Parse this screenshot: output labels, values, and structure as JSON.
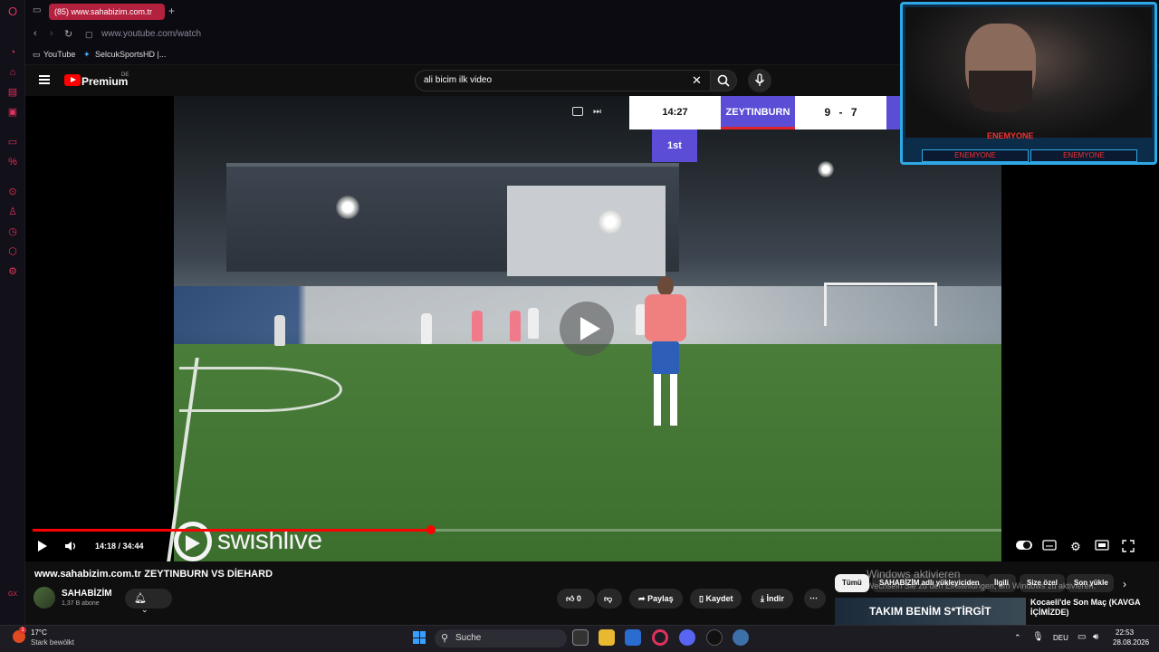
{
  "browser": {
    "tab_title": "(85) www.sahabizim.com.tr",
    "new_tab_symbol": "+",
    "url": "www.youtube.com/watch",
    "bookmarks": [
      "YouTube",
      "SelcukSportsHD |..."
    ],
    "sidebar_label": "GX"
  },
  "youtube": {
    "brand": "Premium",
    "region": "DE",
    "search_query": "ali bicim ilk video",
    "clear_symbol": "✕"
  },
  "player": {
    "current_time": "14:18 / 34:44",
    "progress_fraction": 0.4116,
    "watermark": "swishlive",
    "scoreboard": {
      "clock": "14:27",
      "team": "ZEYTINBURN",
      "score": "9 - 7",
      "period": "1st"
    }
  },
  "webcam": {
    "name": "ENEMYONE",
    "tag_left": "ENEMYONE",
    "tag_right": "ENEMYONE"
  },
  "video_info": {
    "title": "www.sahabizim.com.tr ZEYTINBURN VS DİEHARD",
    "channel": "SAHABİZİM",
    "subscribers": "1,37 B abone",
    "likes": "0",
    "share_label": "Paylaş",
    "save_label": "Kaydet",
    "download_label": "İndir"
  },
  "recommendations": {
    "chips": [
      "Tümü",
      "SAHABİZİM adlı yükleyiciden",
      "İlgili",
      "Size özel",
      "Son yükle"
    ],
    "thumb_text": "TAKIM BENİM S*TİRGİT",
    "first_title": "Kocaeli'de Son Maç (KAVGA İÇİMİZDE)"
  },
  "windows": {
    "activate_title": "Windows aktivieren",
    "activate_sub": "Wechseln Sie zu den Einstellungen, um Windows zu aktivieren.",
    "weather_temp": "17°C",
    "weather_desc": "Stark bewölkt",
    "search_placeholder": "Suche",
    "language": "DEU",
    "time": "22:53",
    "date": "28.08.2026",
    "notification_badge": "1"
  },
  "colors": {
    "accent_red": "#ff0000",
    "score_purple": "#5b4dd6",
    "cam_border": "#2fa8e6",
    "gx_red": "#e0325c"
  }
}
